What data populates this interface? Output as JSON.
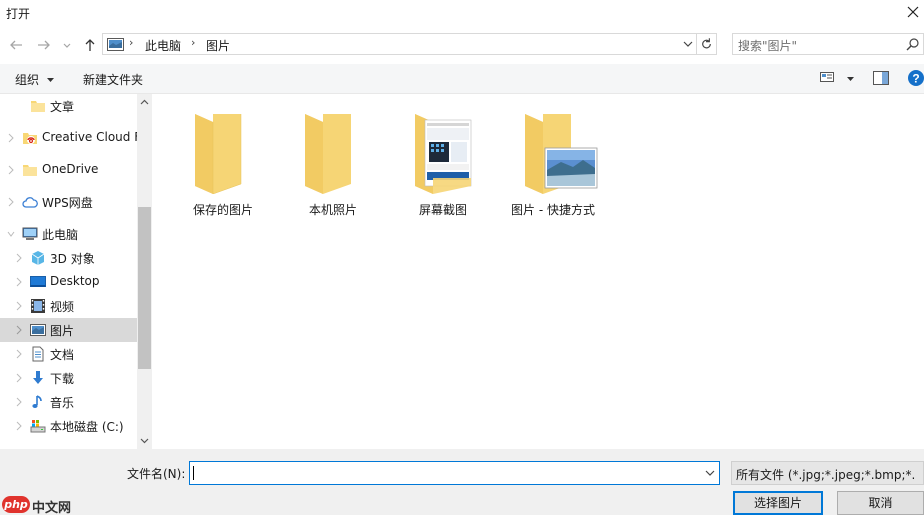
{
  "window": {
    "title": "打开"
  },
  "address": {
    "crumbs": [
      "此电脑",
      "图片"
    ],
    "search_placeholder": "搜索\"图片\""
  },
  "toolbar": {
    "organize": "组织",
    "new_folder": "新建文件夹"
  },
  "nav": {
    "items": [
      {
        "label": "文章",
        "icon": "folder-icon"
      },
      {
        "label": "Creative Cloud F",
        "icon": "creative-cloud-icon"
      },
      {
        "label": "OneDrive",
        "icon": "folder-icon"
      },
      {
        "label": "WPS网盘",
        "icon": "cloud-icon"
      },
      {
        "label": "此电脑",
        "icon": "computer-icon"
      },
      {
        "label": "3D 对象",
        "icon": "cube-icon"
      },
      {
        "label": "Desktop",
        "icon": "desktop-icon"
      },
      {
        "label": "视频",
        "icon": "video-icon"
      },
      {
        "label": "图片",
        "icon": "pictures-icon",
        "selected": true
      },
      {
        "label": "文档",
        "icon": "document-icon"
      },
      {
        "label": "下载",
        "icon": "download-icon"
      },
      {
        "label": "音乐",
        "icon": "music-icon"
      },
      {
        "label": "本地磁盘 (C:)",
        "icon": "drive-icon"
      }
    ]
  },
  "files": [
    {
      "label": "保存的图片",
      "type": "folder"
    },
    {
      "label": "本机照片",
      "type": "folder"
    },
    {
      "label": "屏幕截图",
      "type": "folder-with-screenshot"
    },
    {
      "label": "图片 - 快捷方式",
      "type": "folder-shortcut"
    }
  ],
  "bottom": {
    "filename_label": "文件名(N):",
    "filename_value": "",
    "filter": "所有文件 (*.jpg;*.jpeg;*.bmp;*.",
    "open_button": "选择图片",
    "cancel_button": "取消"
  },
  "watermark": {
    "logo": "php",
    "text": "中文网"
  },
  "colors": {
    "accent": "#0078d7",
    "folder": "#f8d775",
    "selected": "#d9d9d9"
  }
}
